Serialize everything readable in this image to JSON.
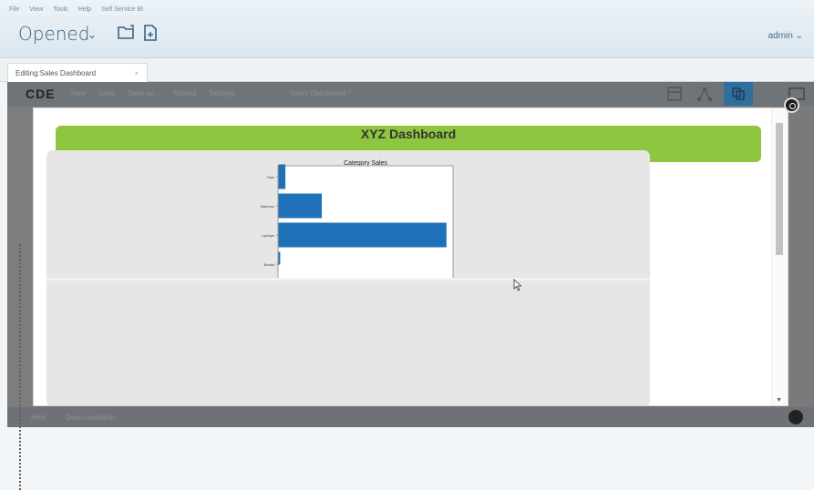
{
  "menu": [
    "File",
    "View",
    "Tools",
    "Help",
    "Self Service BI"
  ],
  "header": {
    "title": "Opened",
    "user": "admin"
  },
  "tab": {
    "label": "Editing:Sales Dashboard",
    "close": "×"
  },
  "cde": {
    "logo": "CDE",
    "menu": [
      "New",
      "Save",
      "Save as...",
      "Reload",
      "Settings"
    ],
    "dashboard_name": "Sales Dashboard *",
    "bottom": [
      "Help",
      "Documentation"
    ]
  },
  "dashboard": {
    "title": "XYZ Dashboard"
  },
  "chart_data": {
    "type": "bar",
    "orientation": "horizontal",
    "title": "Category Sales",
    "categories": [
      "Toys",
      "Watches",
      "Laptops",
      "Books"
    ],
    "values": [
      4,
      25,
      97,
      1
    ],
    "xlim": [
      0,
      100
    ],
    "xlabel": "",
    "ylabel": "",
    "bar_color": "#1f72b8",
    "grid": false,
    "legend": "none"
  },
  "colors": {
    "accent_green": "#8fc63f",
    "bar_blue": "#1f72b8",
    "header_text": "#3e607e"
  },
  "icons": {
    "open_folder": "folder-open-icon",
    "new_file": "new-file-icon",
    "layout": "layout-icon",
    "components": "components-icon",
    "datasources": "datasources-icon",
    "preview": "preview-icon",
    "close": "close-icon",
    "settings": "gear-icon"
  }
}
